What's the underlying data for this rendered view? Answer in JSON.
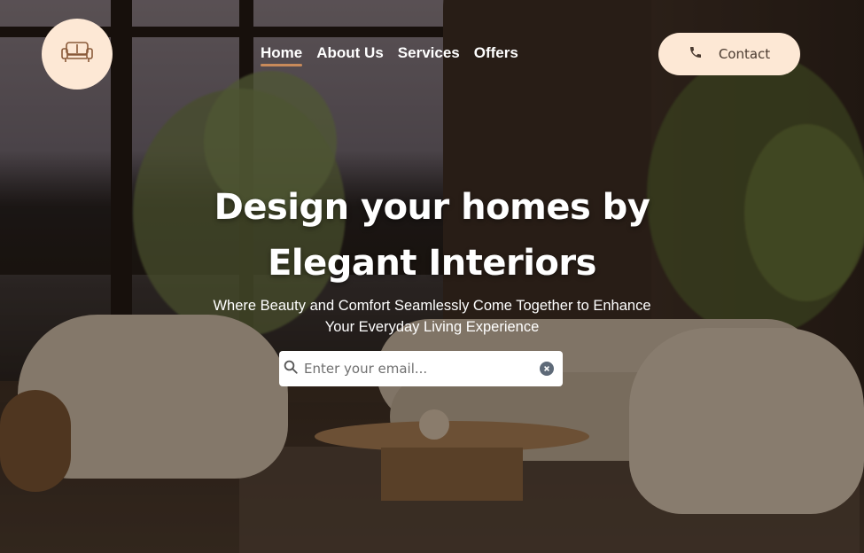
{
  "header": {
    "logo_icon": "sofa-icon",
    "nav": [
      {
        "label": "Home",
        "active": true
      },
      {
        "label": "About Us",
        "active": false
      },
      {
        "label": "Services",
        "active": false
      },
      {
        "label": "Offers",
        "active": false
      }
    ],
    "contact": {
      "label": "Contact",
      "icon": "phone-icon"
    }
  },
  "hero": {
    "title_line1": "Design your homes by",
    "title_line2": "Elegant Interiors",
    "subtitle_line1": "Where Beauty and Comfort Seamlessly Come Together to Enhance",
    "subtitle_line2": "Your Everyday Living Experience",
    "search": {
      "placeholder": "Enter your email...",
      "value": "",
      "icon": "search-icon",
      "clear_icon": "clear-icon"
    }
  },
  "colors": {
    "accent_peach": "#fde8d5",
    "nav_underline": "#c88a5a",
    "text_white": "#ffffff"
  }
}
